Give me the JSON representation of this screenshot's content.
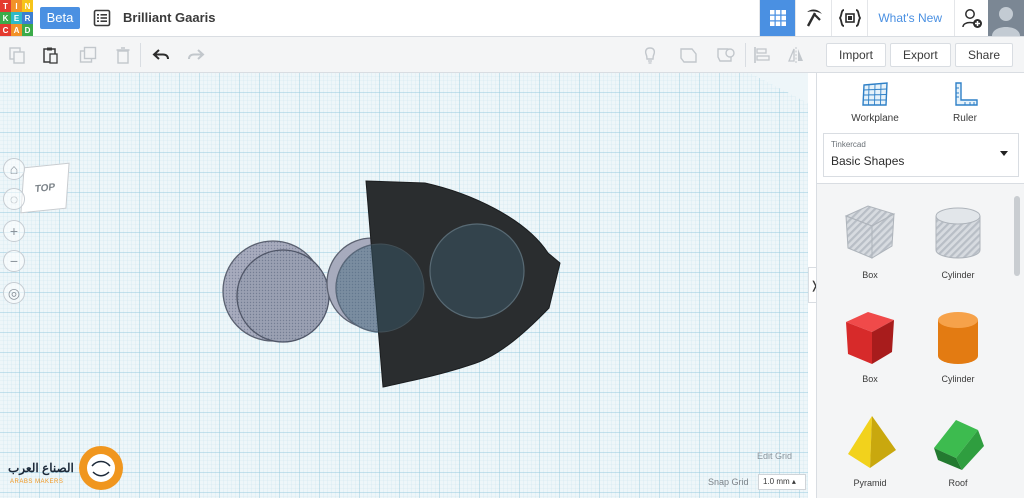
{
  "app": {
    "logo_letters": [
      "T",
      "I",
      "N",
      "K",
      "E",
      "R",
      "C",
      "A",
      "D"
    ],
    "beta_label": "Beta",
    "design_title": "Brilliant Gaaris",
    "whats_new": "What's New"
  },
  "topbar_icons": [
    "3d-view-grid-icon",
    "pickaxe-icon",
    "codeblocks-icon",
    "add-user-icon",
    "user-avatar"
  ],
  "toolbar": {
    "icons": [
      "copy-icon",
      "paste-icon",
      "duplicate-icon",
      "delete-icon",
      "undo-icon",
      "redo-icon",
      "note-icon",
      "show-all-icon",
      "group-icon",
      "align-icon",
      "mirror-icon"
    ],
    "import_label": "Import",
    "export_label": "Export",
    "share_label": "Share"
  },
  "viewcube": {
    "face": "TOP"
  },
  "panel": {
    "workplane_label": "Workplane",
    "ruler_label": "Ruler",
    "library_caption": "Tinkercad",
    "library_value": "Basic Shapes",
    "shapes": [
      {
        "label": "Box",
        "style": "hole"
      },
      {
        "label": "Cylinder",
        "style": "hole"
      },
      {
        "label": "Box",
        "style": "solid",
        "color": "#d72a2a"
      },
      {
        "label": "Cylinder",
        "style": "solid",
        "color": "#e37b12"
      },
      {
        "label": "Pyramid",
        "style": "solid",
        "color": "#f2d21c"
      },
      {
        "label": "Roof",
        "style": "solid",
        "color": "#2f9e3f"
      }
    ]
  },
  "canvas": {
    "edit_grid_label": "Edit Grid",
    "snap_grid_label": "Snap Grid",
    "snap_grid_value": "1.0 mm"
  },
  "watermark": {
    "arabic_text": "الصناع العرب",
    "english_text": "ARABS MAKERS"
  },
  "colors": {
    "accent": "#4a90e2",
    "grid_line": "#a9d4e6",
    "workplane": "#eef6f9",
    "dark_shape": "#2a2d2f",
    "hole_fill": "#8f97a6"
  }
}
